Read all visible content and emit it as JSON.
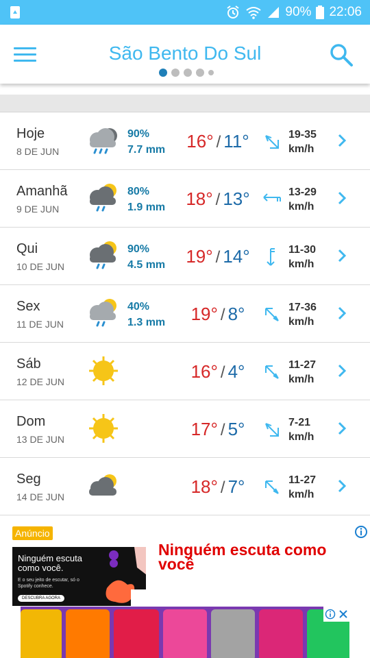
{
  "status_bar": {
    "battery": "90%",
    "time": "22:06"
  },
  "header": {
    "city": "São Bento Do Sul"
  },
  "forecast": [
    {
      "day": "Hoje",
      "date": "8 DE JUN",
      "icon": "rain-cloud-icon",
      "precip_pct": "90%",
      "precip_mm": "7.7 mm",
      "tmax": "16°",
      "tmin": "11°",
      "wind": "19-35",
      "wind_unit": "km/h"
    },
    {
      "day": "Amanhã",
      "date": "9 DE JUN",
      "icon": "sun-rain-cloud-icon",
      "precip_pct": "80%",
      "precip_mm": "1.9 mm",
      "tmax": "18°",
      "tmin": "13°",
      "wind": "13-29",
      "wind_unit": "km/h"
    },
    {
      "day": "Qui",
      "date": "10 DE JUN",
      "icon": "sun-rain-cloud-icon",
      "precip_pct": "90%",
      "precip_mm": "4.5 mm",
      "tmax": "19°",
      "tmin": "14°",
      "wind": "11-30",
      "wind_unit": "km/h"
    },
    {
      "day": "Sex",
      "date": "11 DE JUN",
      "icon": "sun-rain-cloud-icon",
      "precip_pct": "40%",
      "precip_mm": "1.3 mm",
      "tmax": "19°",
      "tmin": "8°",
      "wind": "17-36",
      "wind_unit": "km/h"
    },
    {
      "day": "Sáb",
      "date": "12 DE JUN",
      "icon": "sun-icon",
      "precip_pct": "",
      "precip_mm": "",
      "tmax": "16°",
      "tmin": "4°",
      "wind": "11-27",
      "wind_unit": "km/h"
    },
    {
      "day": "Dom",
      "date": "13 DE JUN",
      "icon": "sun-icon",
      "precip_pct": "",
      "precip_mm": "",
      "tmax": "17°",
      "tmin": "5°",
      "wind": "7-21",
      "wind_unit": "km/h"
    },
    {
      "day": "Seg",
      "date": "14 DE JUN",
      "icon": "sun-cloud-icon",
      "precip_pct": "",
      "precip_mm": "",
      "tmax": "18°",
      "tmin": "7°",
      "wind": "11-27",
      "wind_unit": "km/h"
    }
  ],
  "ad": {
    "badge": "Anúncio",
    "headline": "Ninguém escuta como você",
    "image_title": "Ninguém escuta como você.",
    "image_text": "E o seu jeito de escutar, só o Spotify conhece.",
    "image_button": "DESCUBRA AGORA"
  },
  "colors": {
    "accent": "#3fb8ef",
    "tmax": "#d62828",
    "tmin": "#1c6aa8",
    "precip": "#167aa6",
    "ad_badge": "#f5b400",
    "ad_headline": "#e00000"
  }
}
